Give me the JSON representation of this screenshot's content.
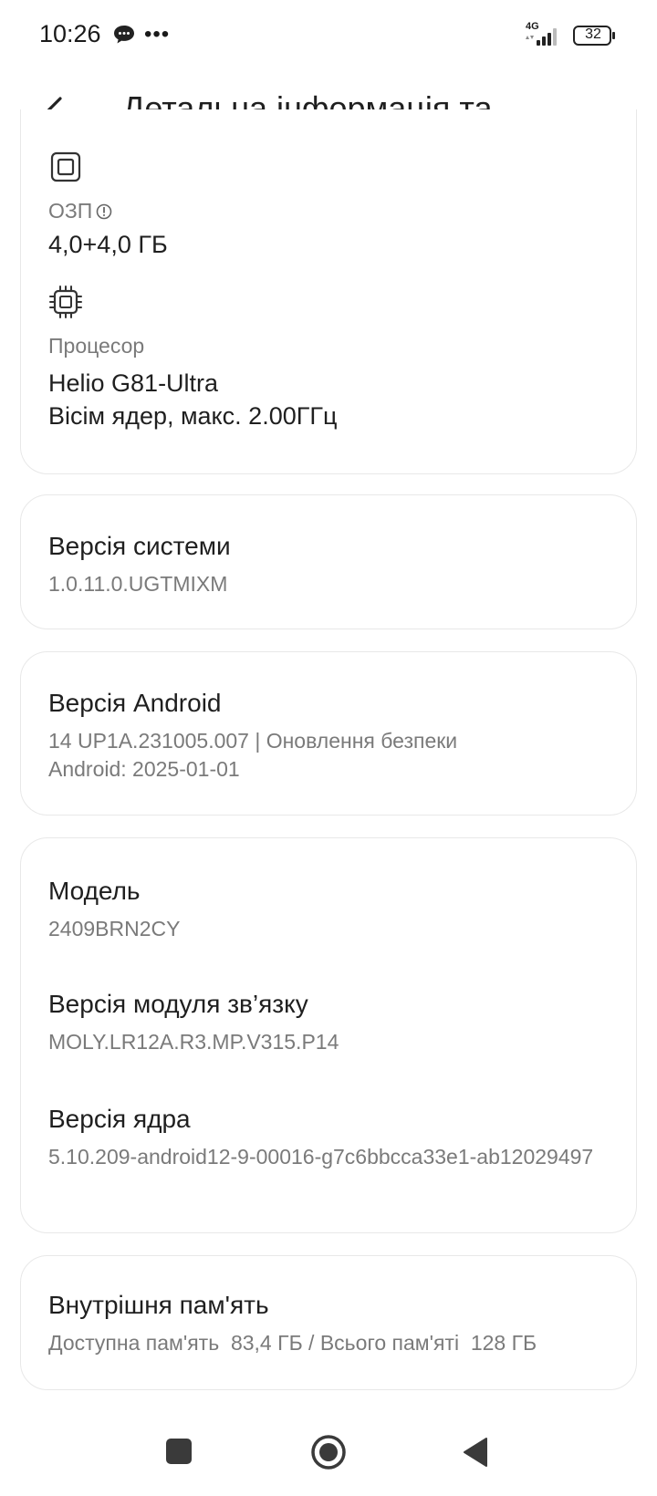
{
  "status_bar": {
    "time": "10:26",
    "network": "4G",
    "battery": "32"
  },
  "header": {
    "title": "Детальна інформація та..."
  },
  "specs": {
    "ram": {
      "label": "ОЗП",
      "value": "4,0+4,0 ГБ"
    },
    "cpu": {
      "label": "Процесор",
      "line1": "Helio G81-Ultra",
      "line2": "Вісім ядер, макс. 2.00ГГц"
    }
  },
  "system_version": {
    "title": "Версія системи",
    "value": "1.0.11.0.UGTMIXM"
  },
  "android_version": {
    "title": "Версія Android",
    "value": "14 UP1A.231005.007 | Оновлення безпеки Android: 2025-01-01"
  },
  "device": {
    "model_title": "Модель",
    "model_value": "2409BRN2CY",
    "baseband_title": "Версія модуля зв’язку",
    "baseband_value": "MOLY.LR12A.R3.MP.V315.P14",
    "kernel_title": "Версія ядра",
    "kernel_value": "5.10.209-android12-9-00016-g7c6bbcca33e1-ab12029497"
  },
  "storage": {
    "title": "Внутрішня пам'ять",
    "value": "Доступна пам'ять  83,4 ГБ / Всього пам'яті  128 ГБ"
  }
}
